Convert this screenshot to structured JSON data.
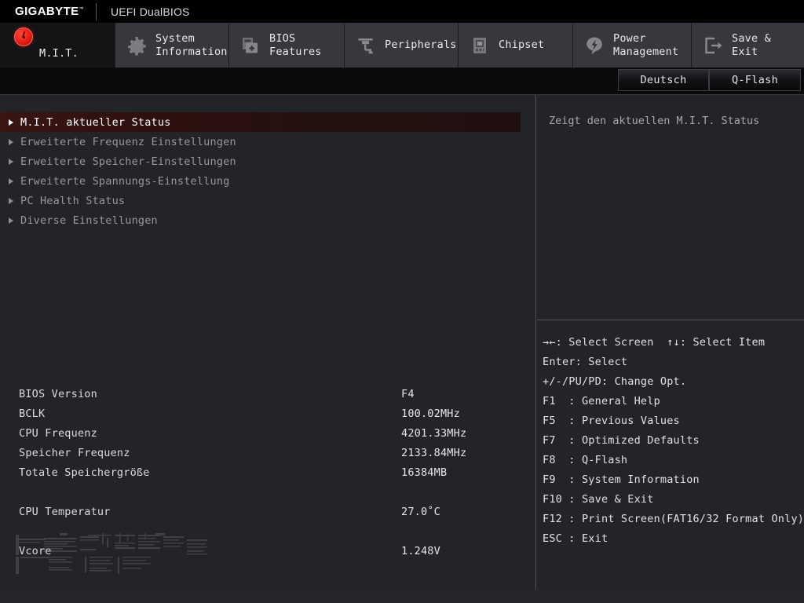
{
  "brand": {
    "logo": "GIGABYTE",
    "trademark": "™",
    "subtitle": "UEFI DualBIOS"
  },
  "tabs": [
    {
      "id": "mit",
      "label": "M.I.T.",
      "icon": "gauge-icon",
      "active": true
    },
    {
      "id": "sysinfo",
      "label": "System\nInformation",
      "icon": "gear-icon",
      "active": false
    },
    {
      "id": "bios",
      "label": "BIOS\nFeatures",
      "icon": "bios-chip-icon",
      "active": false
    },
    {
      "id": "periph",
      "label": "Peripherals",
      "icon": "plug-icon",
      "active": false
    },
    {
      "id": "chipset",
      "label": "Chipset",
      "icon": "chipset-icon",
      "active": false
    },
    {
      "id": "power",
      "label": "Power\nManagement",
      "icon": "bolt-icon",
      "active": false
    },
    {
      "id": "saveexit",
      "label": "Save & Exit",
      "icon": "exit-icon",
      "active": false
    }
  ],
  "utilbar": {
    "language": "Deutsch",
    "qflash": "Q-Flash"
  },
  "menu": [
    {
      "label": "M.I.T. aktueller Status",
      "selected": true
    },
    {
      "label": "Erweiterte Frequenz Einstellungen",
      "selected": false
    },
    {
      "label": "Erweiterte Speicher-Einstellungen",
      "selected": false
    },
    {
      "label": "Erweiterte Spannungs-Einstellung",
      "selected": false
    },
    {
      "label": "PC Health Status",
      "selected": false
    },
    {
      "label": "Diverse Einstellungen",
      "selected": false
    }
  ],
  "info_rows": [
    {
      "key": "BIOS Version",
      "value": "F4",
      "gap": false
    },
    {
      "key": "BCLK",
      "value": "100.02MHz",
      "gap": false
    },
    {
      "key": "CPU Frequenz",
      "value": "4201.33MHz",
      "gap": false
    },
    {
      "key": "Speicher Frequenz",
      "value": "2133.84MHz",
      "gap": false
    },
    {
      "key": "Totale Speichergröße",
      "value": "16384MB",
      "gap": false
    },
    {
      "key": "CPU Temperatur",
      "value": "27.0˚C",
      "gap": true
    },
    {
      "key": "Vcore",
      "value": "1.248V",
      "gap": true
    }
  ],
  "help": {
    "text": "Zeigt den aktuellen M.I.T. Status"
  },
  "legend": [
    "→←: Select Screen  ↑↓: Select Item",
    "Enter: Select",
    "+/-/PU/PD: Change Opt.",
    "F1  : General Help",
    "F5  : Previous Values",
    "F7  : Optimized Defaults",
    "F8  : Q-Flash",
    "F9  : System Information",
    "F10 : Save & Exit",
    "F12 : Print Screen(FAT16/32 Format Only)",
    "ESC : Exit"
  ],
  "colors": {
    "background": "#232428",
    "tab_bar": "#0a0a0b",
    "tab_inactive": "#37383d",
    "tab_active": "#141416",
    "accent_red": "#e81d13",
    "selection": "#3a1512",
    "text": "#dcdcde",
    "text_dim": "#97989c"
  }
}
